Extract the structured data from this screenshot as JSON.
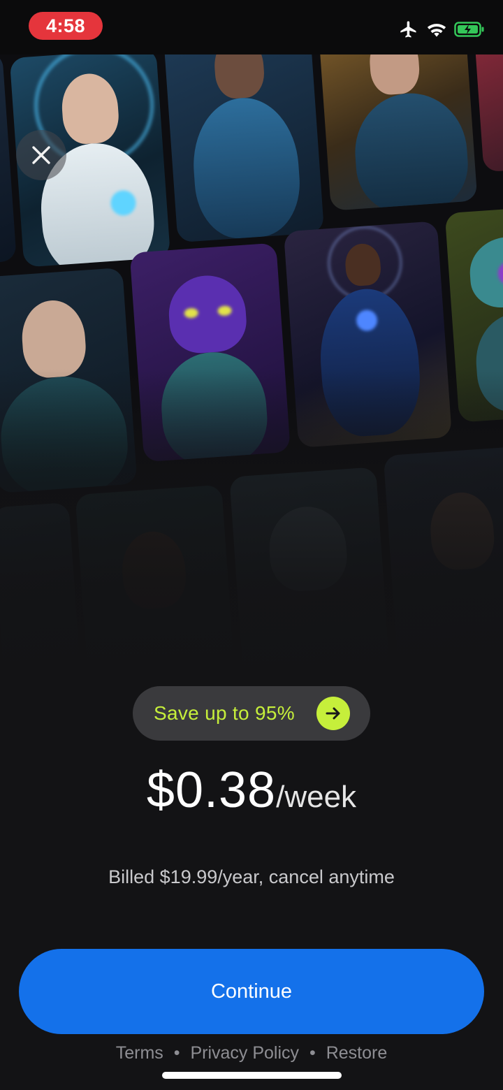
{
  "status_bar": {
    "time": "4:58",
    "time_pill_color": "#e5353c",
    "icons": [
      "airplane-icon",
      "wifi-icon",
      "battery-charging-icon"
    ],
    "battery_color": "#34c759"
  },
  "close_button": {
    "icon": "close-icon"
  },
  "offer": {
    "save_badge": "Save up to 95%",
    "save_badge_color": "#c6ef3b",
    "price": "$0.38",
    "period": "/week",
    "billing_note": "Billed $19.99/year, cancel anytime"
  },
  "cta": {
    "label": "Continue",
    "color": "#1471ea"
  },
  "footer_links": {
    "terms": "Terms",
    "separator": "•",
    "privacy": "Privacy Policy",
    "restore": "Restore"
  }
}
